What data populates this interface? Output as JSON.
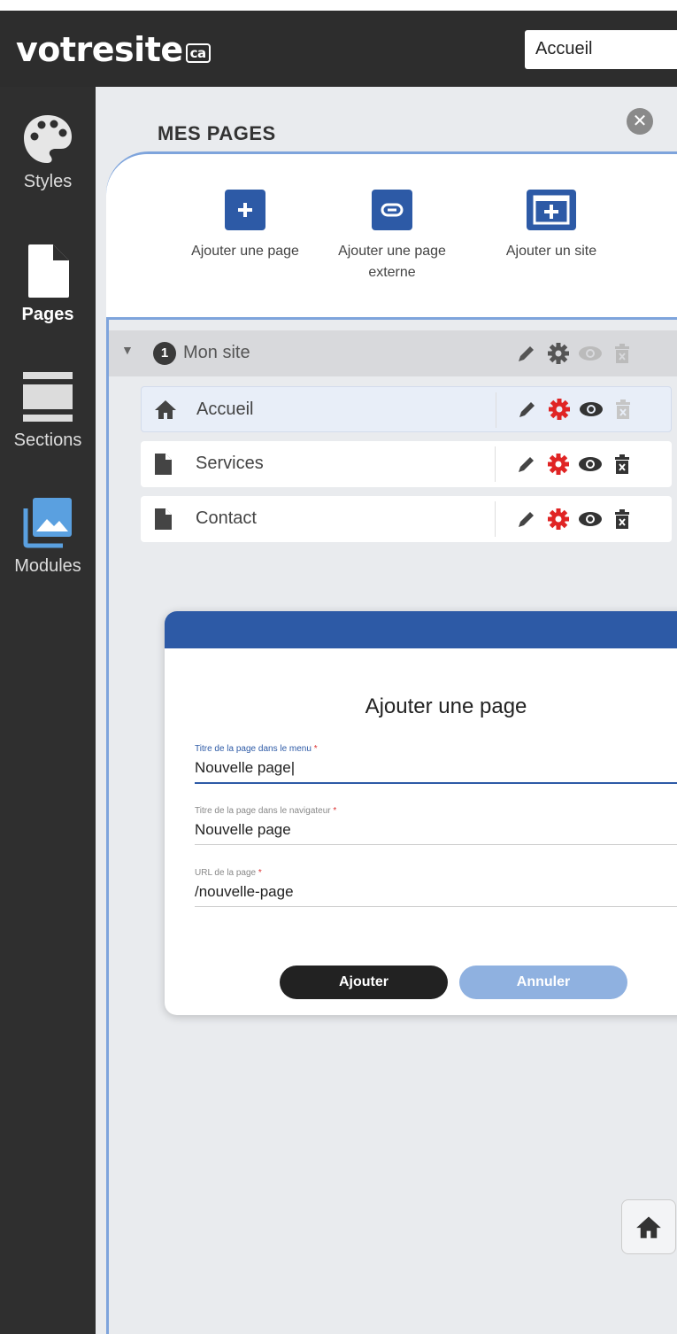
{
  "header": {
    "logo_main": "votresite",
    "logo_tld": "ca",
    "page_select_value": "Accueil"
  },
  "sidebar": {
    "items": [
      {
        "label": "Styles",
        "icon": "palette-icon"
      },
      {
        "label": "Pages",
        "icon": "page-icon",
        "active": true
      },
      {
        "label": "Sections",
        "icon": "sections-icon"
      },
      {
        "label": "Modules",
        "icon": "image-icon"
      }
    ]
  },
  "panel": {
    "title": "MES PAGES",
    "actions": [
      {
        "label": "Ajouter une page",
        "icon": "plus-icon"
      },
      {
        "label": "Ajouter une page externe",
        "icon": "link-icon"
      },
      {
        "label": "Ajouter un site",
        "icon": "add-site-icon"
      }
    ],
    "tree_root": {
      "number": "1",
      "name": "Mon site"
    },
    "pages": [
      {
        "name": "Accueil",
        "icon": "home-icon"
      },
      {
        "name": "Services",
        "icon": "document-icon"
      },
      {
        "name": "Contact",
        "icon": "document-icon"
      }
    ]
  },
  "dialog": {
    "title": "Ajouter une page",
    "fields": [
      {
        "label": "Titre de la page dans le menu",
        "value": "Nouvelle page|"
      },
      {
        "label": "Titre de la page dans le navigateur",
        "value": "Nouvelle page"
      },
      {
        "label": "URL de la page",
        "value": "/nouvelle-page"
      }
    ],
    "required_marker": "*",
    "submit_label": "Ajouter",
    "cancel_label": "Annuler"
  },
  "colors": {
    "brand_blue": "#2d5aa6",
    "gear_red": "#e02424",
    "dark": "#2d2d2d"
  }
}
